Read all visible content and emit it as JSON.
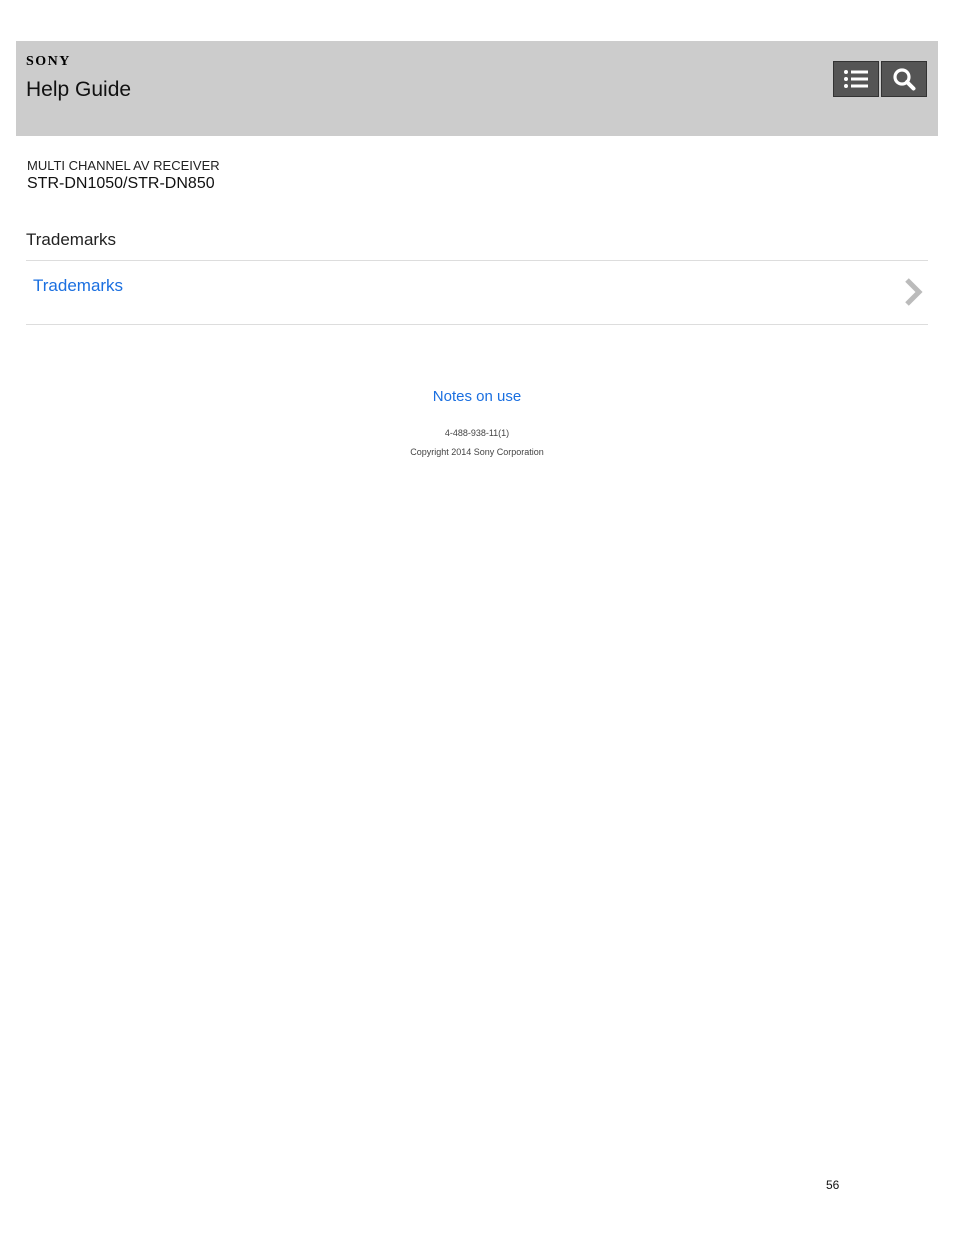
{
  "header": {
    "brand": "SONY",
    "title": "Help Guide",
    "toc_button_icon": "list-icon",
    "search_button_icon": "search-icon"
  },
  "product": {
    "category": "MULTI CHANNEL AV RECEIVER",
    "model": "STR-DN1050/STR-DN850"
  },
  "section": {
    "title": "Trademarks",
    "topics": [
      {
        "label": "Trademarks",
        "icon": "chevron-right-icon"
      }
    ]
  },
  "footer": {
    "link_label": "Notes on use",
    "doc_number": "4-488-938-11(1)",
    "copyright": "Copyright 2014 Sony Corporation"
  },
  "page": {
    "number": "56"
  },
  "colors": {
    "header_bg": "#cccccc",
    "button_bg": "#555555",
    "link": "#1a6fe0",
    "divider": "#dddddd"
  }
}
